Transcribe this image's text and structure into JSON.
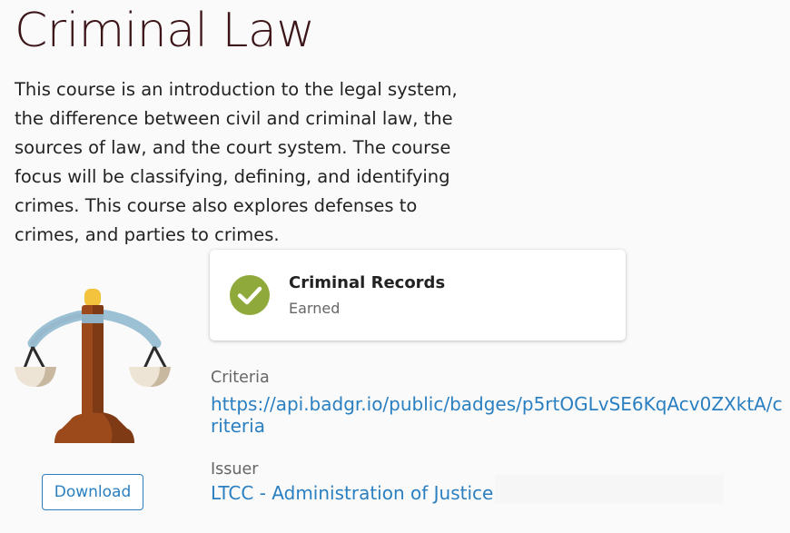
{
  "course": {
    "title": "Criminal Law",
    "description": "This course is an introduction to the legal system, the difference between civil and criminal law, the sources of law, and the court system. The course focus will be classifying, defining, and identifying crimes. This course also explores defenses to crimes, and parties to crimes."
  },
  "badge": {
    "image_icon": "scales-of-justice-icon",
    "download_label": "Download"
  },
  "status_card": {
    "icon": "check-circle-icon",
    "title": "Criminal Records",
    "status": "Earned"
  },
  "criteria": {
    "label": "Criteria",
    "url": "https://api.badgr.io/public/badges/p5rtOGLvSE6KqAcv0ZXktA/criteria"
  },
  "issuer": {
    "label": "Issuer",
    "name": "LTCC - Administration of Justice"
  },
  "colors": {
    "title": "#3b1518",
    "link": "#2a7fc1",
    "check": "#8faa3a",
    "scale_wood": "#9c4a1c",
    "scale_arm": "#9cc0d4",
    "scale_knob": "#f3c33d",
    "pan": "#ede4d6"
  }
}
